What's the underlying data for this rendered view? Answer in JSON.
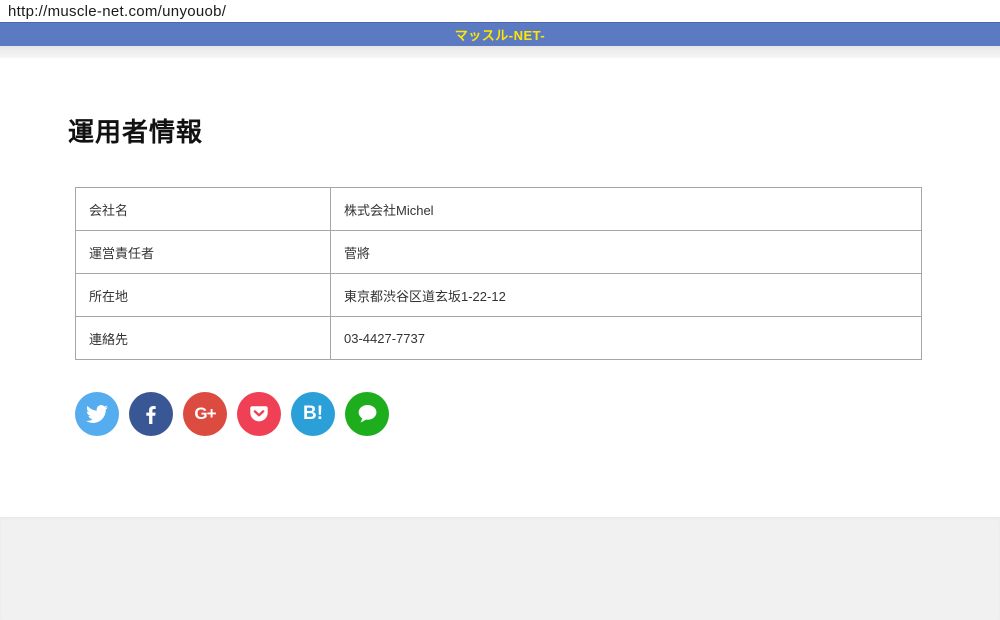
{
  "browser": {
    "url": "http://muscle-net.com/unyouob/"
  },
  "header": {
    "title": "マッスル-NET-",
    "bg_color": "#5b7ac1",
    "title_color": "#ffe600"
  },
  "page": {
    "heading": "運用者情報"
  },
  "info_table": {
    "rows": [
      {
        "label": "会社名",
        "value": "株式会社Michel"
      },
      {
        "label": "運営責任者",
        "value": "菅將"
      },
      {
        "label": "所在地",
        "value": "東京都渋谷区道玄坂1-22-12"
      },
      {
        "label": "連絡先",
        "value": "03-4427-7737"
      }
    ]
  },
  "social": {
    "buttons": [
      {
        "name": "twitter",
        "color": "#55acee"
      },
      {
        "name": "facebook",
        "color": "#3a5795"
      },
      {
        "name": "google-plus",
        "color": "#db4b3f",
        "glyph_text": "G+"
      },
      {
        "name": "pocket",
        "color": "#ef4056"
      },
      {
        "name": "hatena",
        "color": "#2b9fd8",
        "glyph_text": "B!"
      },
      {
        "name": "line",
        "color": "#1dad1d"
      }
    ]
  }
}
